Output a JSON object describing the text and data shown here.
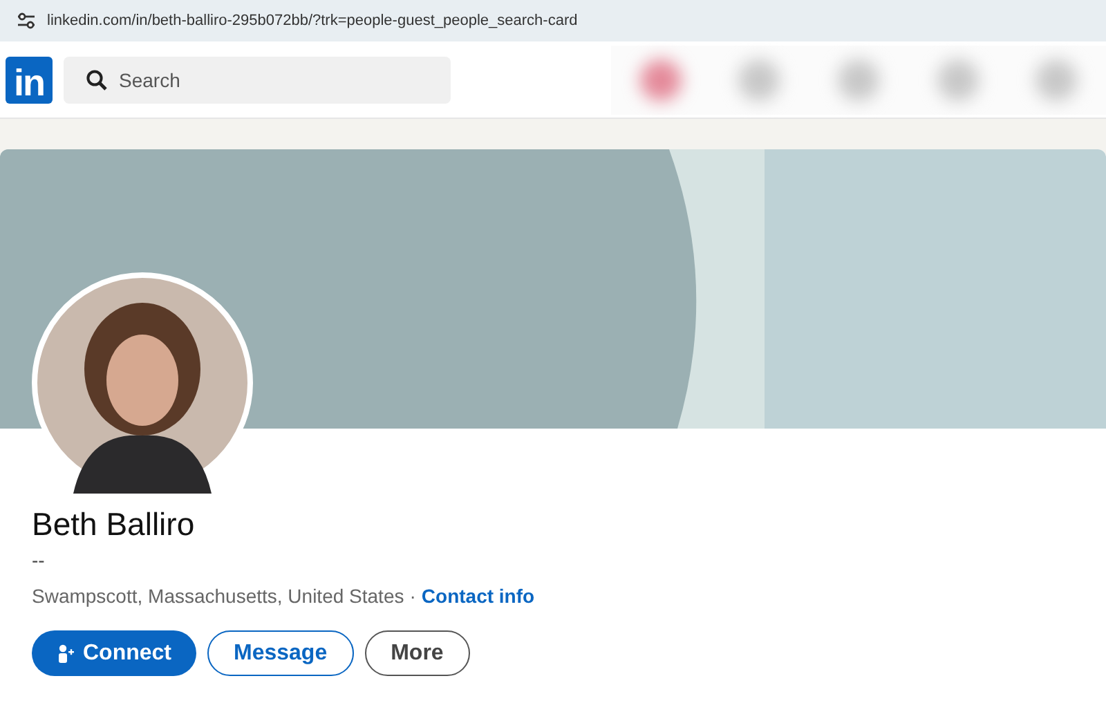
{
  "address_bar": {
    "url": "linkedin.com/in/beth-balliro-295b072bb/?trk=people-guest_people_search-card"
  },
  "header": {
    "logo": "in",
    "search": {
      "placeholder": "Search"
    }
  },
  "profile": {
    "name": "Beth Balliro",
    "headline": "--",
    "location": "Swampscott, Massachusetts, United States",
    "separator": "·",
    "contact_link": "Contact info"
  },
  "buttons": [
    {
      "kind": "primary",
      "label": "Connect"
    },
    {
      "kind": "outline",
      "label": "Message"
    },
    {
      "kind": "neutral",
      "label": "More"
    }
  ]
}
